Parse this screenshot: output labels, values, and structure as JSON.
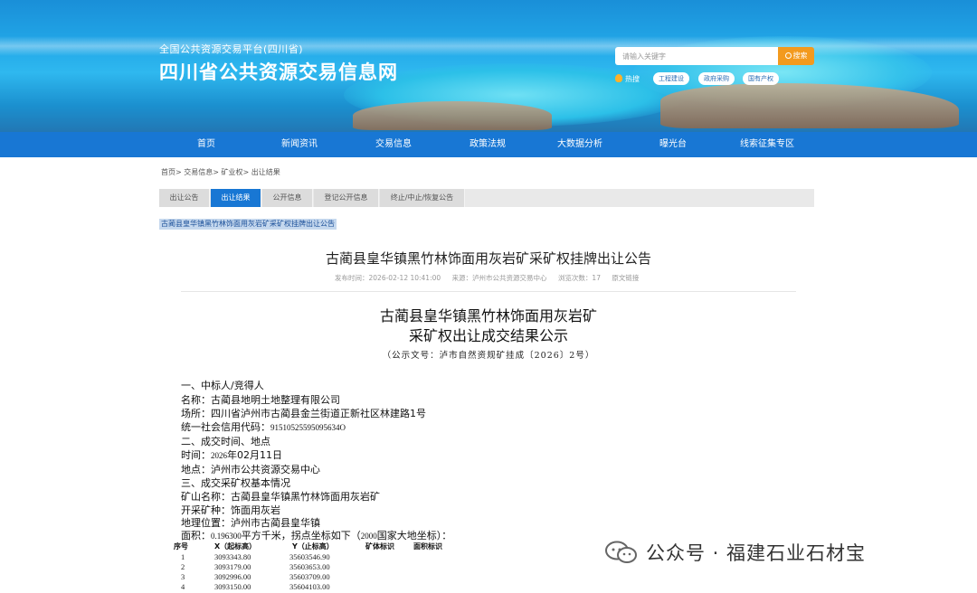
{
  "header": {
    "subtitle": "全国公共资源交易平台(四川省)",
    "title": "四川省公共资源交易信息网",
    "search": {
      "placeholder": "请输入关键字",
      "button_label": "搜索"
    },
    "hot_label": "热搜",
    "hot_tags": [
      "工程建设",
      "政府采购",
      "国有产权"
    ]
  },
  "nav": {
    "items": [
      "首页",
      "新闻资讯",
      "交易信息",
      "政策法规",
      "大数据分析",
      "曝光台",
      "线索征集专区"
    ]
  },
  "breadcrumb": "首页> 交易信息> 矿业权> 出让结果",
  "tabs": {
    "items": [
      "出让公告",
      "出让结果",
      "公开信息",
      "登记公开信息",
      "终止/中止/恢复公告"
    ],
    "active": "出让结果"
  },
  "selected_link": "古蔺县皇华镇黑竹林饰面用灰岩矿采矿权挂牌出让公告",
  "article": {
    "title": "古蔺县皇华镇黑竹林饰面用灰岩矿采矿权挂牌出让公告",
    "meta": {
      "publish_time": "发布时间：2026-02-12 10:41:00",
      "source": "来源：泸州市公共资源交易中心",
      "views": "浏览次数：17",
      "original_link": "原文链接"
    }
  },
  "document": {
    "title_line1": "古蔺县皇华镇黑竹林饰面用灰岩矿",
    "title_line2": "采矿权出让成交结果公示",
    "doc_number": "（公示文号：泸市自然资规矿挂成〔2026〕2号）",
    "section1": "一、中标人/竞得人",
    "name": "名称：古蔺县地明土地整理有限公司",
    "address": "场所：四川省泸州市古蔺县金兰街道正新社区林建路1号",
    "credit_label": "统一社会信用代码：",
    "credit_value": "91510525595095634O",
    "section2": "二、成交时间、地点",
    "time_label": "时间：",
    "time_year": "2026",
    "time_rest": "年02月11日",
    "place": "地点：泸州市公共资源交易中心",
    "section3": "三、成交采矿权基本情况",
    "mine_name": "矿山名称：古蔺县皇华镇黑竹林饰面用灰岩矿",
    "mineral": "开采矿种：饰面用灰岩",
    "location": "地理位置：泸州市古蔺县皇华镇",
    "area_label": "面积：",
    "area_value": "0.196300",
    "area_rest": "平方千米，拐点坐标如下（",
    "coord_system": "2000",
    "area_end": "国家大地坐标）："
  },
  "table": {
    "headers": [
      "序号",
      "X（起标高）",
      "Y（止标高）",
      "矿体标识",
      "面积标识"
    ],
    "rows": [
      [
        "1",
        "3093343.80",
        "35603546.90"
      ],
      [
        "2",
        "3093179.00",
        "35603653.00"
      ],
      [
        "3",
        "3092996.00",
        "35603709.00"
      ],
      [
        "4",
        "3093150.00",
        "35604103.00"
      ]
    ]
  },
  "watermark": "公众号 · 福建石业石材宝",
  "colors": {
    "nav_blue": "#1877d4",
    "search_orange": "#f39a1e",
    "link_highlight": "#c5d8ee"
  }
}
